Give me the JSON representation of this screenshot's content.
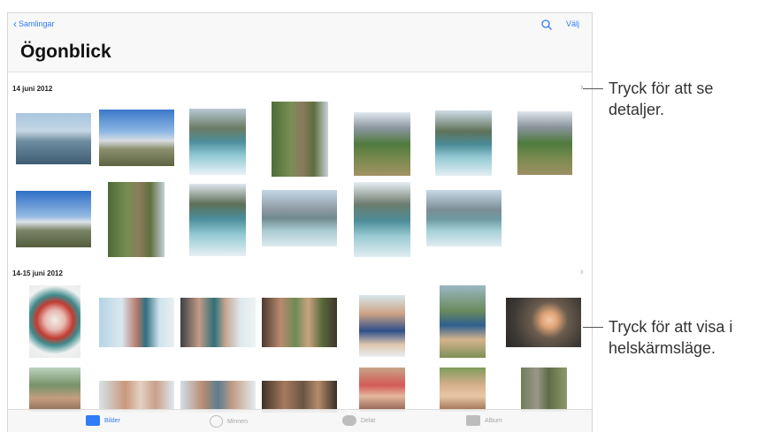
{
  "nav": {
    "back_label": "Samlingar",
    "select_label": "Välj",
    "title": "Ögonblick"
  },
  "sections": [
    {
      "date": "14 juni 2012"
    },
    {
      "date": "14-15 juni 2012"
    }
  ],
  "tabs": [
    {
      "label": "Bilder"
    },
    {
      "label": "Minnen"
    },
    {
      "label": "Delat"
    },
    {
      "label": "Album"
    }
  ],
  "callouts": [
    {
      "text": "Tryck för att se detaljer."
    },
    {
      "text": "Tryck för att visa i helskärmsläge."
    }
  ],
  "colors": {
    "accent": "#2f7cf6",
    "title": "#111111",
    "callout_text": "#333333"
  }
}
